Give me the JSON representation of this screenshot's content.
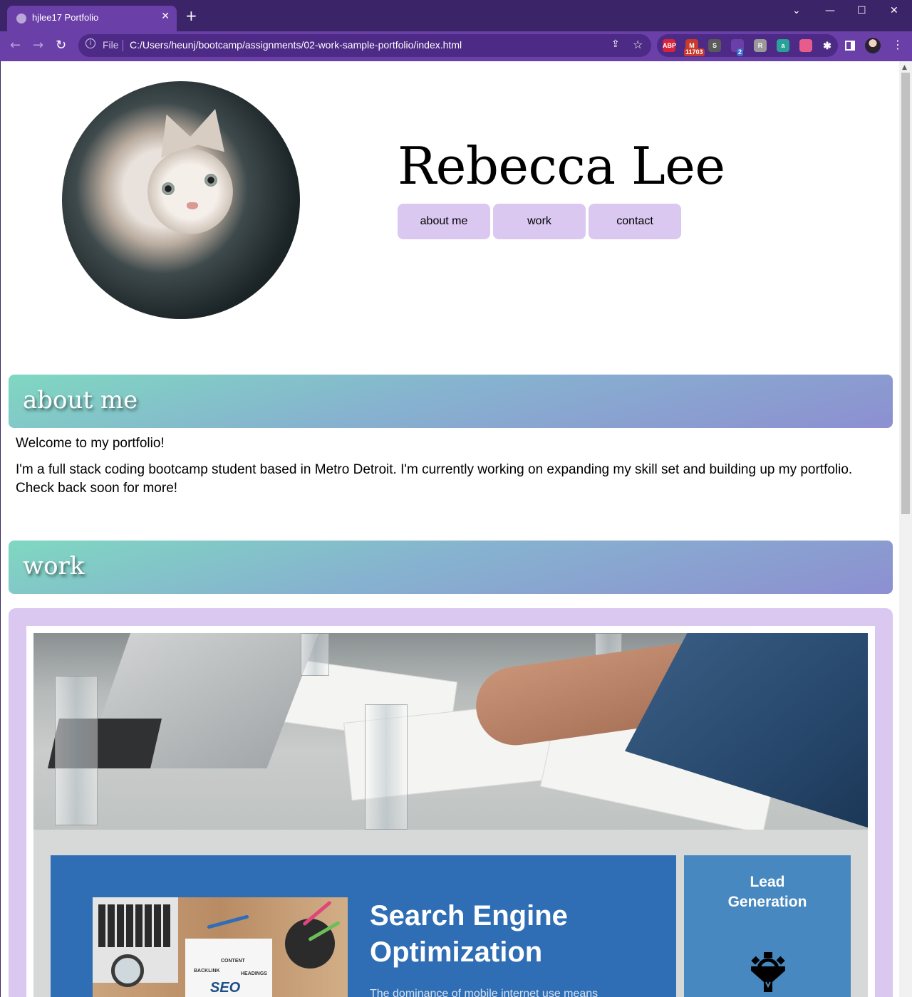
{
  "browser": {
    "tab_title": "hjlee17 Portfolio",
    "tab_close": "✕",
    "new_tab": "+",
    "address_scheme": "File",
    "address_url": "C:/Users/heunj/bootcamp/assignments/02-work-sample-portfolio/index.html",
    "extensions": [
      {
        "name": "adblock-plus",
        "label": "ABP",
        "color": "#d8243a"
      },
      {
        "name": "gmail-checker",
        "label": "M",
        "color": "#c73a2e",
        "badge": "11703"
      },
      {
        "name": "script-extension",
        "label": "S",
        "color": "#5a5a5a"
      },
      {
        "name": "extension-purple",
        "label": "",
        "color": "#6a3fa8",
        "badge": "2"
      },
      {
        "name": "extension-grey",
        "label": "R",
        "color": "#9a9a9a"
      },
      {
        "name": "extension-teal",
        "label": "a",
        "color": "#2aa198"
      },
      {
        "name": "extension-pink",
        "label": "",
        "color": "#e75c8a"
      }
    ]
  },
  "site": {
    "name": "Rebecca Lee",
    "nav": [
      "about me",
      "work",
      "contact"
    ]
  },
  "about": {
    "heading": "about me",
    "welcome": "Welcome to my portfolio!",
    "bio": "I'm a full stack coding bootcamp student based in Metro Detroit. I'm currently working on expanding my skill set and building up my portfolio. Check back soon for more!"
  },
  "work": {
    "heading": "work",
    "seo": {
      "title_line1": "Search Engine",
      "title_line2": "Optimization",
      "blurb": "The dominance of mobile internet use means",
      "note_lines": [
        "CONTENT",
        "BACKLINK",
        "HEADINGS"
      ],
      "note_word": "SEO"
    },
    "lead": {
      "title_line1": "Lead",
      "title_line2": "Generation"
    }
  },
  "colors": {
    "titlebar": "#3c2468",
    "toolbar": "#6a3fa8",
    "nav_button": "#dac8f1",
    "section_gradient_start": "#7fd8c1",
    "section_gradient_end": "#8d8fd1",
    "seo_panel": "#2f6eb4",
    "lead_panel": "#4688bf"
  }
}
